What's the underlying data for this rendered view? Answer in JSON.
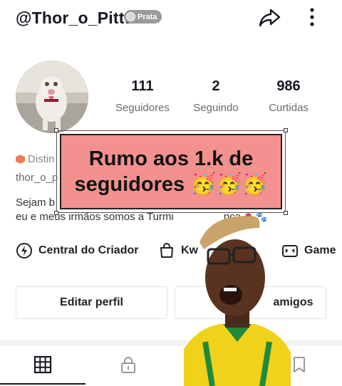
{
  "header": {
    "username": "@Thor_o_Pittt",
    "badge_label": "Prata",
    "share_icon": "share-arrow-icon",
    "more_icon": "more-vertical-icon"
  },
  "stats": [
    {
      "value": "111",
      "label": "Seguidores"
    },
    {
      "value": "2",
      "label": "Seguindo"
    },
    {
      "value": "986",
      "label": "Curtidas"
    }
  ],
  "bio": {
    "distinction": "Distin",
    "handle": "thor_o_p",
    "line1": "Sejam b",
    "line2": "eu e meus irmãos somos a Turmi",
    "line2_end": "nça"
  },
  "overlay": {
    "line1": "Rumo aos 1.k de",
    "line2": "seguidores 🥳🥳🥳",
    "color": "#f2918e"
  },
  "quick_actions": [
    {
      "label": "Central do Criador",
      "icon": "creator-center-icon"
    },
    {
      "label": "Kw",
      "icon": "shopping-bag-icon"
    },
    {
      "label": "Game",
      "icon": "gamepad-icon"
    }
  ],
  "buttons": {
    "edit_profile": "Editar perfil",
    "add_friends": "amigos"
  },
  "tabs": [
    {
      "name": "videos",
      "icon": "grid-icon",
      "active": true
    },
    {
      "name": "private",
      "icon": "lock-icon",
      "active": false
    },
    {
      "name": "reposts",
      "icon": "repost-icon",
      "active": false
    },
    {
      "name": "favorites",
      "icon": "bookmark-icon",
      "active": false
    }
  ]
}
